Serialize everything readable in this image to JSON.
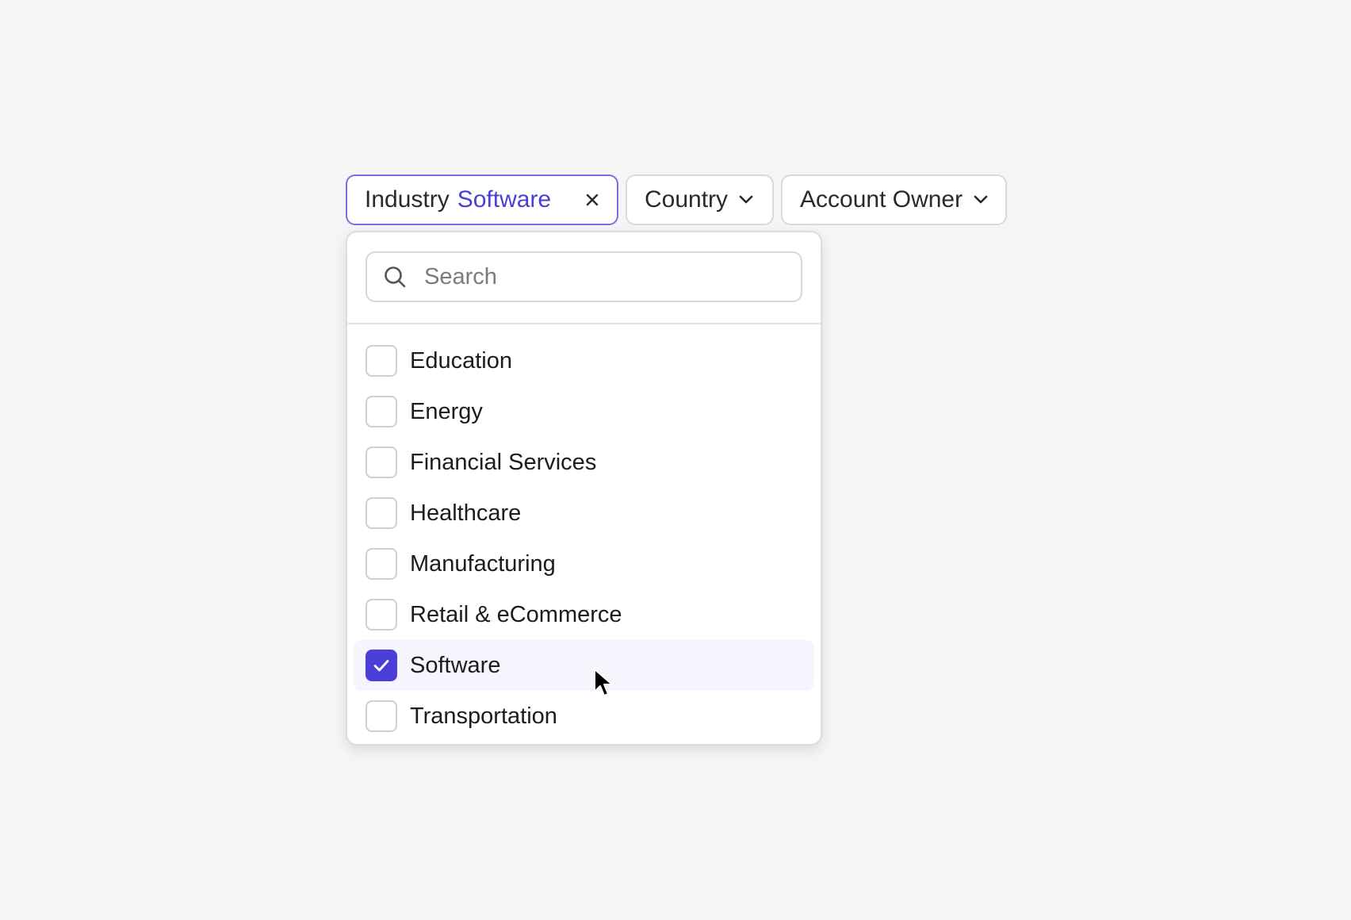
{
  "filters": {
    "industry": {
      "label": "Industry",
      "value": "Software"
    },
    "country": {
      "label": "Country"
    },
    "account_owner": {
      "label": "Account Owner"
    }
  },
  "dropdown": {
    "search_placeholder": "Search",
    "options": [
      {
        "label": "Education",
        "checked": false
      },
      {
        "label": "Energy",
        "checked": false
      },
      {
        "label": "Financial Services",
        "checked": false
      },
      {
        "label": "Healthcare",
        "checked": false
      },
      {
        "label": "Manufacturing",
        "checked": false
      },
      {
        "label": "Retail & eCommerce",
        "checked": false
      },
      {
        "label": "Software",
        "checked": true
      },
      {
        "label": "Transportation",
        "checked": false
      }
    ]
  },
  "colors": {
    "accent": "#4a3fd6",
    "active_border": "#7b6fe0",
    "hover_bg": "#f6f5fd",
    "background": "#f5f5f5"
  },
  "icons": {
    "search": "search-icon",
    "close": "close-icon",
    "chevron": "chevron-down-icon",
    "check": "check-icon",
    "cursor": "cursor-icon"
  }
}
